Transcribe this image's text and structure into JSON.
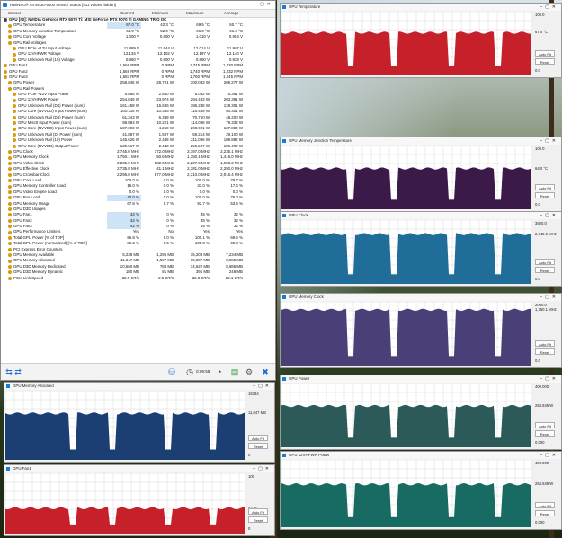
{
  "main_window": {
    "title": "HWiNFO® 64 v8.30-5800 Sensor Status [411 values hidden]",
    "columns": [
      "Sensor",
      "Current",
      "Minimum",
      "Maximum",
      "Average"
    ],
    "rows": [
      {
        "label": "GPU [#0]: NVIDIA GeForce RTX 5070 Ti: MSI GeForce RTX 5070 Ti GAMING TRIO OC",
        "type": "group",
        "indent": 0
      },
      {
        "label": "GPU Temperature",
        "cur": "67.0 °C",
        "min": "42.3 °C",
        "max": "69.5 °C",
        "avg": "60.7 °C",
        "indent": 1,
        "sel": true
      },
      {
        "label": "GPU Memory Junction Temperature",
        "cur": "64.0 °C",
        "min": "52.0 °C",
        "max": "66.0 °C",
        "avg": "61.3 °C",
        "indent": 1
      },
      {
        "label": "GPU Core Voltage",
        "cur": "1.000 V",
        "min": "0.800 V",
        "max": "1.010 V",
        "avg": "0.954 V",
        "indent": 1
      },
      {
        "label": "GPU Rail Voltages",
        "type": "sub",
        "indent": 1
      },
      {
        "label": "GPU PCIe +12V Input Voltage",
        "cur": "11.889 V",
        "min": "11.844 V",
        "max": "12.014 V",
        "avg": "11.907 V",
        "indent": 2
      },
      {
        "label": "GPU 12VHPWR Voltage",
        "cur": "12.134 V",
        "min": "12.102 V",
        "max": "12.197 V",
        "avg": "12.140 V",
        "indent": 2
      },
      {
        "label": "GPU Unknown Rail (10) Voltage",
        "cur": "0.860 V",
        "min": "0.800 V",
        "max": "0.860 V",
        "avg": "0.828 V",
        "indent": 2
      },
      {
        "label": "GPU Fan1",
        "cur": "1,566 RPM",
        "min": "0 RPM",
        "max": "1,745 RPM",
        "avg": "1,230 RPM",
        "indent": 0
      },
      {
        "label": "GPU Fan2",
        "cur": "1,568 RPM",
        "min": "0 RPM",
        "max": "1,740 RPM",
        "avg": "1,232 RPM",
        "indent": 0
      },
      {
        "label": "GPU Fan3",
        "cur": "1,583 RPM",
        "min": "0 RPM",
        "max": "1,760 RPM",
        "avg": "1,245 RPM",
        "indent": 0
      },
      {
        "label": "GPU Power",
        "cur": "258.845 W",
        "min": "28.721 W",
        "max": "300.033 W",
        "avg": "209.277 W",
        "indent": 1
      },
      {
        "label": "GPU Rail Powers",
        "type": "sub",
        "indent": 1
      },
      {
        "label": "GPU PCIe +12V Input Power",
        "cur": "5.885 W",
        "min": "2.860 W",
        "max": "6.062 W",
        "avg": "5.361 W",
        "indent": 2
      },
      {
        "label": "GPU 12VHPWR Power",
        "cur": "254.849 W",
        "min": "23.974 W",
        "max": "294.483 W",
        "avg": "203.391 W",
        "indent": 2
      },
      {
        "label": "GPU Unknown Rail (D4) Power (sum)",
        "cur": "161.459 W",
        "min": "16.685 W",
        "max": "186.248 W",
        "avg": "128.301 W",
        "indent": 2
      },
      {
        "label": "GPU Core (NVVDD) Input Power (sum)",
        "cur": "100.116 W",
        "min": "10.346 W",
        "max": "115.489 W",
        "avg": "80.301 W",
        "indent": 2
      },
      {
        "label": "GPU Unknown Rail (D4) Power (sum)",
        "cur": "61.343 W",
        "min": "6.339 W",
        "max": "70.760 W",
        "avg": "48.200 W",
        "indent": 2
      },
      {
        "label": "GPU Misc0 Input Power (sum)",
        "cur": "98.884 W",
        "min": "10.221 W",
        "max": "114.096 W",
        "avg": "79.332 W",
        "indent": 2
      },
      {
        "label": "GPU Core (NVVDD) Input Power (sum)",
        "cur": "187.293 W",
        "min": "4.218 W",
        "max": "208.921 W",
        "avg": "137.882 W",
        "indent": 2
      },
      {
        "label": "GPU Unknown Rail (D) Power (sum)",
        "cur": "41.887 W",
        "min": "1.597 W",
        "max": "59.214 W",
        "avg": "29.100 W",
        "indent": 2
      },
      {
        "label": "GPU Unknown Rail (10) Power",
        "cur": "145.626 W",
        "min": "2.448 W",
        "max": "211.096 W",
        "avg": "109.882 W",
        "indent": 2
      },
      {
        "label": "GPU Core (NVVDD) Output Power",
        "cur": "139.517 W",
        "min": "2.448 W",
        "max": "256.527 W",
        "avg": "109.400 W",
        "indent": 2
      },
      {
        "label": "GPU Clock",
        "cur": "2,745.0 MHz",
        "min": "172.0 MHz",
        "max": "2,797.0 MHz",
        "avg": "2,235.1 MHz",
        "indent": 1
      },
      {
        "label": "GPU Memory Clock",
        "cur": "1,750.1 MHz",
        "min": "50.6 MHz",
        "max": "1,750.1 MHz",
        "avg": "1,416.0 MHz",
        "indent": 1
      },
      {
        "label": "GPU Video Clock",
        "cur": "2,205.0 MHz",
        "min": "582.0 MHz",
        "max": "2,227.0 MHz",
        "avg": "1,908.2 MHz",
        "indent": 1
      },
      {
        "label": "GPU Effective Clock",
        "cur": "2,735.8 MHz",
        "min": "41.1 MHz",
        "max": "2,781.0 MHz",
        "avg": "2,250.0 MHz",
        "indent": 1
      },
      {
        "label": "GPU Crossbar Clock",
        "cur": "2,295.0 MHz",
        "min": "877.0 MHz",
        "max": "2,310.0 MHz",
        "avg": "2,016.4 MHz",
        "indent": 1
      },
      {
        "label": "GPU Core Load",
        "cur": "100.0 %",
        "min": "0.0 %",
        "max": "100.0 %",
        "avg": "78.7 %",
        "indent": 1
      },
      {
        "label": "GPU Memory Controller Load",
        "cur": "16.0 %",
        "min": "0.0 %",
        "max": "31.0 %",
        "avg": "17.6 %",
        "indent": 1
      },
      {
        "label": "GPU Video Engine Load",
        "cur": "0.0 %",
        "min": "0.0 %",
        "max": "0.0 %",
        "avg": "0.0 %",
        "indent": 1
      },
      {
        "label": "GPU Bus Load",
        "cur": "40.0 %",
        "min": "0.0 %",
        "max": "100.0 %",
        "avg": "76.0 %",
        "indent": 1,
        "sel": true
      },
      {
        "label": "GPU Memory Usage",
        "cur": "67.8 %",
        "min": "9.7 %",
        "max": "92.7 %",
        "avg": "53.6 %",
        "indent": 1
      },
      {
        "label": "GPU D3D Usages",
        "type": "sub",
        "indent": 1
      },
      {
        "label": "GPU Fan1",
        "cur": "42 %",
        "min": "0 %",
        "max": "45 %",
        "avg": "32 %",
        "indent": 1,
        "sel": true
      },
      {
        "label": "GPU Fan2",
        "cur": "42 %",
        "min": "0 %",
        "max": "45 %",
        "avg": "32 %",
        "indent": 1,
        "sel": true
      },
      {
        "label": "GPU Fan3",
        "cur": "42 %",
        "min": "0 %",
        "max": "45 %",
        "avg": "32 %",
        "indent": 1,
        "sel": true
      },
      {
        "label": "GPU Performance Limiters",
        "cur": "Yes",
        "min": "No",
        "max": "Yes",
        "avg": "Yes",
        "indent": 1
      },
      {
        "label": "Total GPU Power [% of TDP]",
        "cur": "86.8 %",
        "min": "9.0 %",
        "max": "100.1 %",
        "avg": "69.6 %",
        "indent": 1
      },
      {
        "label": "Total GPU Power (normalized) [% of TDP]",
        "cur": "89.2 %",
        "min": "9.5 %",
        "max": "105.3 %",
        "avg": "69.4 %",
        "indent": 1
      },
      {
        "label": "PCI Express Error Counters",
        "type": "sub",
        "indent": 1
      },
      {
        "label": "GPU Memory Available",
        "cur": "5,238 MB",
        "min": "1,296 MB",
        "max": "15,208 MB",
        "avg": "7,234 MB",
        "indent": 1
      },
      {
        "label": "GPU Memory Allocated",
        "cur": "11,047 MB",
        "min": "1,597 MB",
        "max": "15,007 MB",
        "avg": "8,989 MB",
        "indent": 1
      },
      {
        "label": "GPU D3D Memory Dedicated",
        "cur": "10,660 MB",
        "min": "784 MB",
        "max": "14,622 MB",
        "avg": "8,686 MB",
        "indent": 1
      },
      {
        "label": "GPU D3D Memory Dynamic",
        "cur": "180 MB",
        "min": "81 MB",
        "max": "391 MB",
        "avg": "246 MB",
        "indent": 1
      },
      {
        "label": "PCIe Link Speed",
        "cur": "32.0 GT/s",
        "min": "2.5 GT/s",
        "max": "32.0 GT/s",
        "avg": "28.1 GT/s",
        "indent": 1
      }
    ],
    "toolbar": {
      "time": "0:09:58"
    }
  },
  "graphs": [
    {
      "id": "g-temp",
      "title": "GPU Temperature",
      "ymax": "100.0",
      "cur": "67.0 °C",
      "ymin": "0.0",
      "color": "#c6202a",
      "level": 0.67,
      "autofit": "Auto Fit",
      "reset": "Reset"
    },
    {
      "id": "g-memtemp",
      "title": "GPU Memory Junction Temperature",
      "ymax": "100.0",
      "cur": "64.0 °C",
      "ymin": "0.0",
      "color": "#3b1a4a",
      "level": 0.64,
      "autofit": "Auto Fit",
      "reset": "Reset"
    },
    {
      "id": "g-clock",
      "title": "GPU Clock",
      "ymax": "3500.0",
      "cur": "2,745.0 MHz",
      "ymin": "0.0",
      "color": "#1f6d98",
      "level": 0.78,
      "autofit": "Auto Fit",
      "reset": "Reset"
    },
    {
      "id": "g-memclock",
      "title": "GPU Memory Clock",
      "ymax": "2000.0",
      "cur": "1,750.1 MHz",
      "ymin": "0.0",
      "color": "#4b3f78",
      "level": 0.875,
      "autofit": "Auto Fit",
      "reset": "Reset"
    },
    {
      "id": "g-power",
      "title": "GPU Power",
      "ymax": "400.000",
      "cur": "258.845 W",
      "ymin": "0.000",
      "color": "#2b5a58",
      "level": 0.647,
      "autofit": "Auto Fit",
      "reset": "Reset"
    },
    {
      "id": "g-12v",
      "title": "GPU 12VHPWR Power",
      "ymax": "400.000",
      "cur": "254.849 W",
      "ymin": "0.000",
      "color": "#176b63",
      "level": 0.637,
      "autofit": "Auto Fit",
      "reset": "Reset"
    },
    {
      "id": "g-memalloc",
      "title": "GPU Memory Allocated",
      "ymax": "16384",
      "cur": "11,047 MB",
      "ymin": "0",
      "color": "#1c3f73",
      "level": 0.67,
      "autofit": "Auto Fit",
      "reset": "Reset"
    },
    {
      "id": "g-fan",
      "title": "GPU Fan1",
      "ymax": "100",
      "cur": "42 %",
      "ymin": "0",
      "color": "#c6202a",
      "level": 0.42,
      "autofit": "Auto Fit",
      "reset": "Reset"
    }
  ]
}
